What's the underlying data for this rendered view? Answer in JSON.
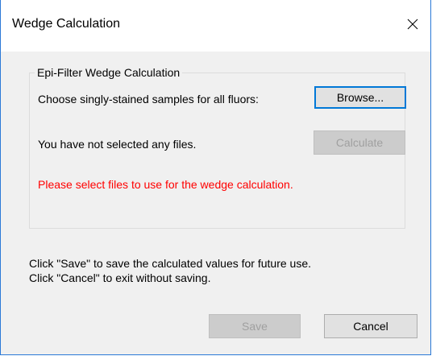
{
  "window": {
    "title": "Wedge Calculation"
  },
  "group": {
    "legend": "Epi-Filter Wedge Calculation",
    "choose_label": "Choose singly-stained samples for all fluors:",
    "browse_label": "Browse...",
    "status_text": "You have not selected any files.",
    "calculate_label": "Calculate",
    "warning_text": "Please select files to use for the wedge calculation.",
    "warning_color": "#ff0000"
  },
  "instructions": {
    "line1": "Click \"Save\" to save the calculated values for future use.",
    "line2": "Click \"Cancel\" to exit without saving."
  },
  "footer": {
    "save_label": "Save",
    "cancel_label": "Cancel"
  },
  "icons": {
    "close": "close-icon"
  }
}
